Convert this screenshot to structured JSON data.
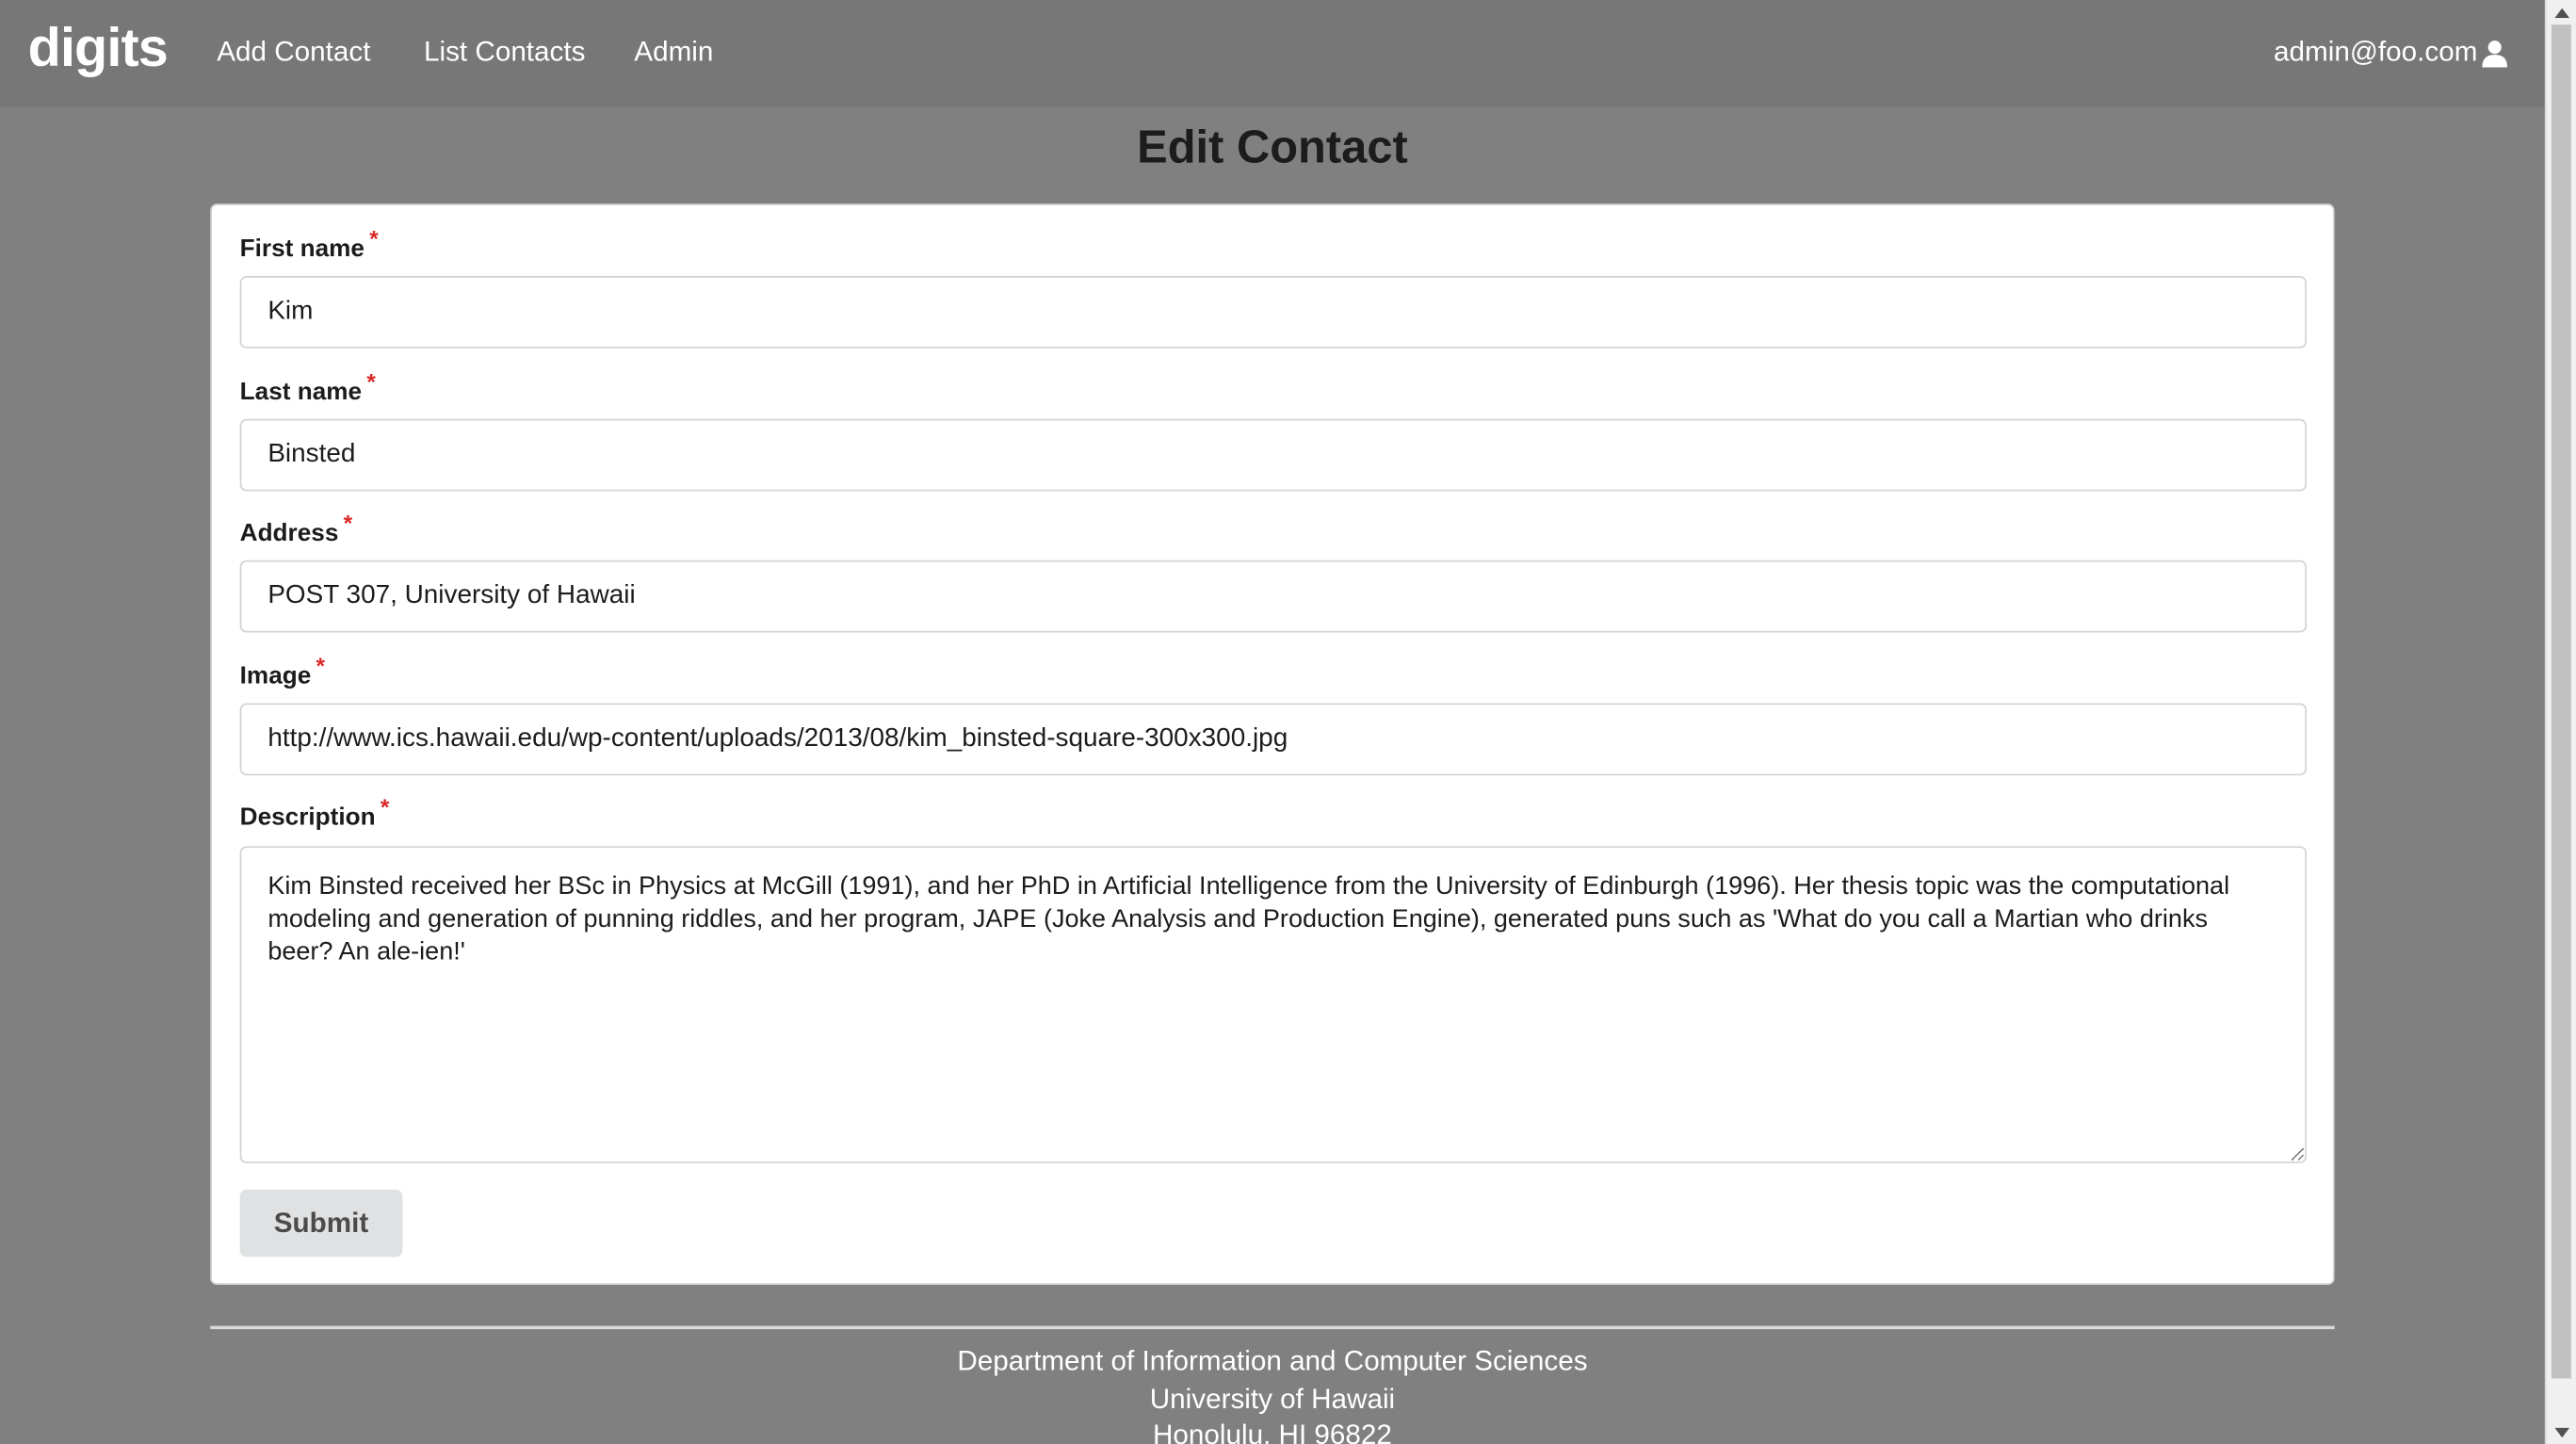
{
  "navbar": {
    "brand": "digits",
    "links": [
      "Add Contact",
      "List Contacts",
      "Admin"
    ],
    "user": "admin@foo.com",
    "user_icon": "user-icon"
  },
  "page": {
    "title": "Edit Contact"
  },
  "form": {
    "first_name": {
      "label": "First name",
      "required": "*",
      "value": "Kim"
    },
    "last_name": {
      "label": "Last name",
      "required": "*",
      "value": "Binsted"
    },
    "address": {
      "label": "Address",
      "required": "*",
      "value": "POST 307, University of Hawaii"
    },
    "image": {
      "label": "Image",
      "required": "*",
      "value": "http://www.ics.hawaii.edu/wp-content/uploads/2013/08/kim_binsted-square-300x300.jpg"
    },
    "description": {
      "label": "Description",
      "required": "*",
      "value": "Kim Binsted received her BSc in Physics at McGill (1991), and her PhD in Artificial Intelligence from the University of Edinburgh (1996). Her thesis topic was the computational modeling and generation of punning riddles, and her program, JAPE (Joke Analysis and Production Engine), generated puns such as 'What do you call a Martian who drinks beer? An ale-ien!'"
    },
    "submit_label": "Submit"
  },
  "footer": {
    "line1": "Department of Information and Computer Sciences",
    "line2": "University of Hawaii",
    "line3": "Honolulu, HI 96822"
  }
}
